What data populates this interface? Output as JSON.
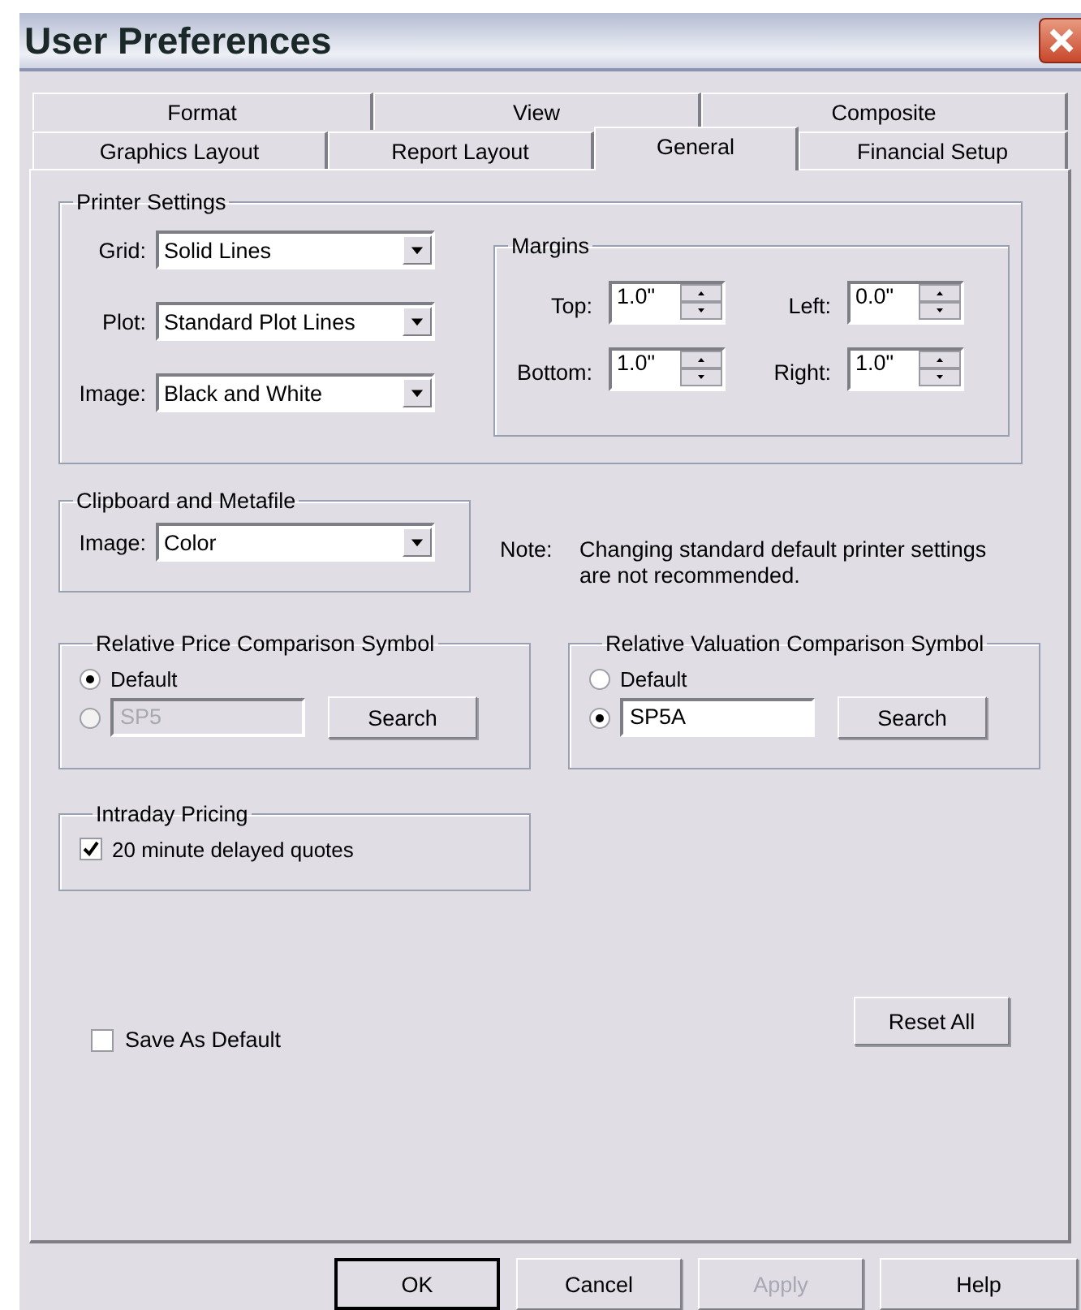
{
  "window": {
    "title": "User Preferences"
  },
  "tab_rows": [
    [
      {
        "label": "Format",
        "selected": false
      },
      {
        "label": "View",
        "selected": false
      },
      {
        "label": "Composite",
        "selected": false
      }
    ],
    [
      {
        "label": "Graphics Layout",
        "selected": false
      },
      {
        "label": "Report Layout",
        "selected": false
      },
      {
        "label": "General",
        "selected": true
      },
      {
        "label": "Financial Setup",
        "selected": false
      }
    ]
  ],
  "printer_settings": {
    "title": "Printer Settings",
    "fields": [
      {
        "label": "Grid:",
        "value": "Solid Lines"
      },
      {
        "label": "Plot:",
        "value": "Standard Plot Lines"
      },
      {
        "label": "Image:",
        "value": "Black and White"
      }
    ],
    "margins": {
      "title": "Margins",
      "fields": [
        {
          "label": "Top:",
          "value": "1.0\""
        },
        {
          "label": "Left:",
          "value": "0.0\""
        },
        {
          "label": "Bottom:",
          "value": "1.0\""
        },
        {
          "label": "Right:",
          "value": "1.0\""
        }
      ]
    }
  },
  "clipboard": {
    "title": "Clipboard and Metafile",
    "fields": [
      {
        "label": "Image:",
        "value": "Color"
      }
    ]
  },
  "note": {
    "label": "Note:",
    "text": "Changing standard default printer settings are not recommended."
  },
  "symbol_groups": [
    {
      "title": "Relative Price Comparison Symbol",
      "options": [
        {
          "kind": "default",
          "label": "Default",
          "selected": true
        },
        {
          "kind": "symbol",
          "value": "SP5",
          "selected": false,
          "disabled": true
        }
      ],
      "button": "Search"
    },
    {
      "title": "Relative Valuation Comparison Symbol",
      "options": [
        {
          "kind": "default",
          "label": "Default",
          "selected": false
        },
        {
          "kind": "symbol",
          "value": "SP5A",
          "selected": true,
          "disabled": false
        }
      ],
      "button": "Search"
    }
  ],
  "intraday": {
    "title": "Intraday Pricing",
    "option": {
      "label": "20 minute delayed quotes",
      "checked": true
    }
  },
  "save_default": {
    "label": "Save As Default",
    "checked": false
  },
  "reset_button": "Reset All",
  "buttons": [
    {
      "label": "OK",
      "default": true,
      "disabled": false
    },
    {
      "label": "Cancel",
      "default": false,
      "disabled": false
    },
    {
      "label": "Apply",
      "default": false,
      "disabled": true
    },
    {
      "label": "Help",
      "default": false,
      "disabled": false
    }
  ]
}
